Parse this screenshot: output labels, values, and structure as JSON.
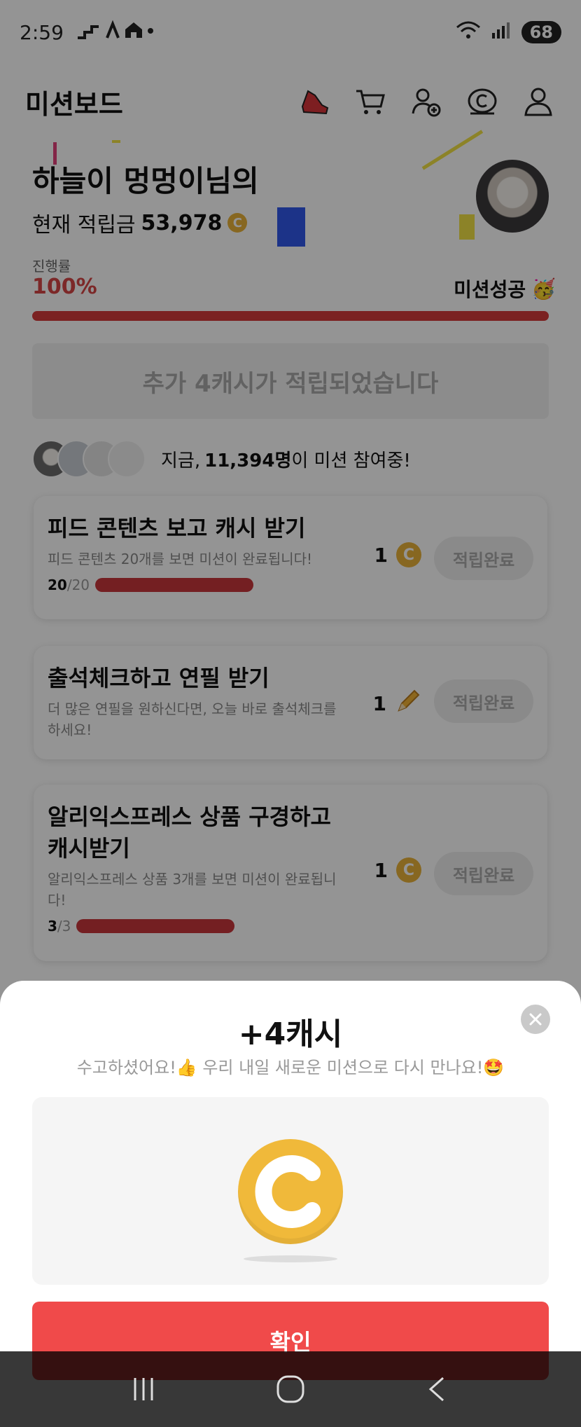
{
  "status_bar": {
    "time": "2:59",
    "battery": "68"
  },
  "header": {
    "title": "미션보드",
    "icons": [
      "sneaker-icon",
      "cart-icon",
      "add-friend-icon",
      "cash-coin-icon",
      "profile-icon"
    ]
  },
  "profile": {
    "name": "하늘이 멍멍이님의",
    "balance_label": "현재 적립금",
    "balance": "53,978"
  },
  "progress": {
    "label": "진행률",
    "value": "100%",
    "fraction": 1.0,
    "status": "미션성공"
  },
  "extra_banner": "추가 4캐시가 적립되었습니다",
  "participants": {
    "prefix": "지금,",
    "count": "11,394명",
    "suffix": "이 미션 참여중!"
  },
  "missions": [
    {
      "title": "피드 콘텐츠 보고 캐시 받기",
      "desc": "피드 콘텐츠 20개를 보면 미션이 완료됩니다!",
      "progress_done": "20",
      "progress_total": "/20",
      "reward": "1",
      "reward_icon": "coin-icon",
      "button": "적립완료"
    },
    {
      "title": "출석체크하고 연필 받기",
      "desc": "더 많은 연필을 원하신다면, 오늘 바로 출석체크를 하세요!",
      "reward": "1",
      "reward_icon": "pencil-icon",
      "button": "적립완료"
    },
    {
      "title": "알리익스프레스 상품 구경하고 캐시받기",
      "desc": "알리익스프레스 상품 3개를 보면 미션이 완료됩니다!",
      "progress_done": "3",
      "progress_total": "/3",
      "reward": "1",
      "reward_icon": "coin-icon",
      "button": "적립완료"
    }
  ],
  "sheet": {
    "title": "+4캐시",
    "subtitle": "수고하셨어요!👍 우리 내일 새로운 미션으로 다시 만나요!🤩",
    "confirm": "확인"
  },
  "colors": {
    "accent_red": "#f04a4a",
    "progress_red": "#d43a3a",
    "coin_gold": "#f0b93a"
  }
}
